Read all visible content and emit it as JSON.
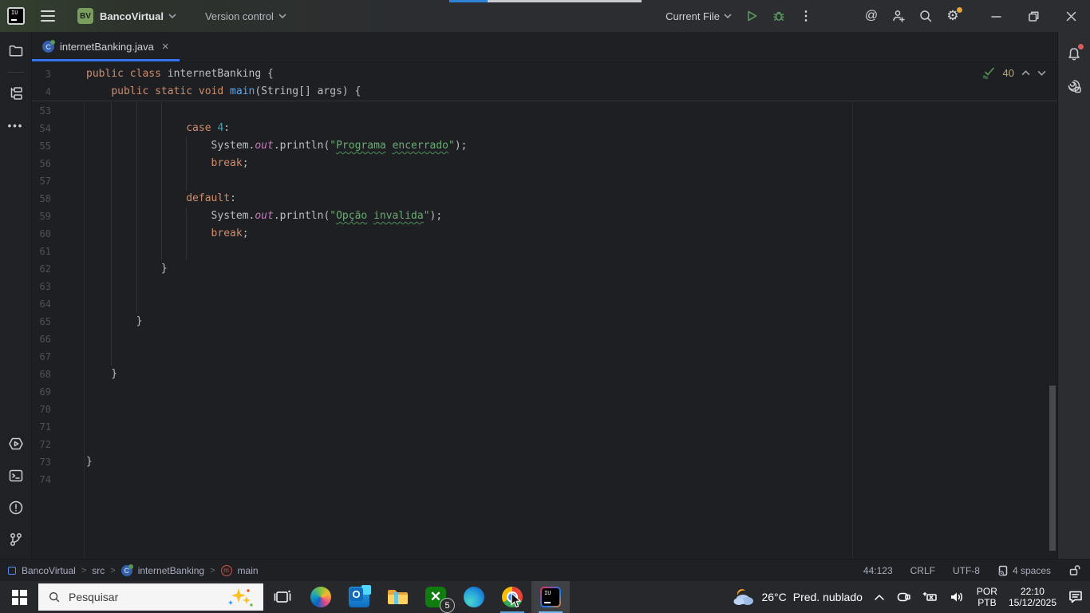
{
  "colors": {
    "accent_blue": "#3574F0",
    "run_green": "#57965C",
    "keyword_orange": "#CF8E6D",
    "string_green": "#6AAB73",
    "warning_count": "#BBA76E",
    "project_avatar_green": "#7A9E5E"
  },
  "title_bar": {
    "app_icon": "intellij-idea-logo",
    "project_name": "BancoVirtual",
    "project_avatar_text": "BV",
    "version_control_label": "Version control",
    "run_widget": {
      "config_label": "Current File"
    },
    "right_icons": [
      "ai-assistant",
      "add-user",
      "search",
      "settings-gear",
      "minimize",
      "maximize-restore",
      "close"
    ]
  },
  "editor_tabs": {
    "active_tab": {
      "label": "internetBanking.java",
      "icon": "java-class",
      "close": "×"
    }
  },
  "editor": {
    "inspection_widget": {
      "count": "40",
      "icon": "inspections-ok-typos"
    },
    "sticky_lines": [
      {
        "n": "3",
        "g": [],
        "t": [
          [
            "public class ",
            "k"
          ],
          [
            "internetBanking {",
            "p"
          ]
        ]
      },
      {
        "n": "4",
        "g": [],
        "t": [
          [
            "    ",
            "p"
          ],
          [
            "public static void ",
            "k"
          ],
          [
            "main",
            "m"
          ],
          [
            "(String[] args) {",
            "p"
          ]
        ]
      }
    ],
    "lines": [
      {
        "n": "53",
        "g": [
          1,
          2,
          3
        ],
        "t": []
      },
      {
        "n": "54",
        "g": [
          1,
          2,
          3
        ],
        "t": [
          [
            "                ",
            "p"
          ],
          [
            "case ",
            "k"
          ],
          [
            "4",
            "n"
          ],
          [
            ":",
            "p"
          ]
        ]
      },
      {
        "n": "55",
        "g": [
          1,
          2,
          3,
          4
        ],
        "t": [
          [
            "                    ",
            "p"
          ],
          [
            "System.",
            "p"
          ],
          [
            "out",
            "f"
          ],
          [
            ".println(",
            "p"
          ],
          [
            "\"",
            "s"
          ],
          [
            "Programa",
            "w"
          ],
          [
            " ",
            "s"
          ],
          [
            "encerrado",
            "w"
          ],
          [
            "\"",
            "s"
          ],
          [
            ");",
            "p"
          ]
        ]
      },
      {
        "n": "56",
        "g": [
          1,
          2,
          3,
          4
        ],
        "t": [
          [
            "                    ",
            "p"
          ],
          [
            "break",
            "k"
          ],
          [
            ";",
            "p"
          ]
        ]
      },
      {
        "n": "57",
        "g": [
          1,
          2,
          3,
          4
        ],
        "t": []
      },
      {
        "n": "58",
        "g": [
          1,
          2,
          3
        ],
        "t": [
          [
            "                ",
            "p"
          ],
          [
            "default",
            "k"
          ],
          [
            ":",
            "p"
          ]
        ]
      },
      {
        "n": "59",
        "g": [
          1,
          2,
          3,
          4
        ],
        "t": [
          [
            "                    ",
            "p"
          ],
          [
            "System.",
            "p"
          ],
          [
            "out",
            "f"
          ],
          [
            ".println(",
            "p"
          ],
          [
            "\"",
            "s"
          ],
          [
            "Opção",
            "w"
          ],
          [
            " ",
            "s"
          ],
          [
            "invalida",
            "w"
          ],
          [
            "\"",
            "s"
          ],
          [
            ");",
            "p"
          ]
        ]
      },
      {
        "n": "60",
        "g": [
          1,
          2,
          3,
          4
        ],
        "t": [
          [
            "                    ",
            "p"
          ],
          [
            "break",
            "k"
          ],
          [
            ";",
            "p"
          ]
        ]
      },
      {
        "n": "61",
        "g": [
          1,
          2,
          3,
          4
        ],
        "t": []
      },
      {
        "n": "62",
        "g": [
          1,
          2
        ],
        "t": [
          [
            "            }",
            "p"
          ]
        ]
      },
      {
        "n": "63",
        "g": [
          1,
          2
        ],
        "t": []
      },
      {
        "n": "64",
        "g": [
          1,
          2
        ],
        "t": []
      },
      {
        "n": "65",
        "g": [
          1
        ],
        "t": [
          [
            "        }",
            "p"
          ]
        ]
      },
      {
        "n": "66",
        "g": [
          1
        ],
        "t": []
      },
      {
        "n": "67",
        "g": [
          1
        ],
        "t": []
      },
      {
        "n": "68",
        "g": [],
        "t": [
          [
            "    }",
            "p"
          ]
        ]
      },
      {
        "n": "69",
        "g": [],
        "t": []
      },
      {
        "n": "70",
        "g": [],
        "t": []
      },
      {
        "n": "71",
        "g": [],
        "t": []
      },
      {
        "n": "72",
        "g": [],
        "t": []
      },
      {
        "n": "73",
        "g": [],
        "t": [
          [
            "}",
            "p"
          ]
        ]
      },
      {
        "n": "74",
        "g": [],
        "t": []
      }
    ]
  },
  "left_toolbar": {
    "icons": [
      "project-folder",
      "structure",
      "more-tool-windows",
      "services",
      "terminal",
      "problems",
      "version-control-branch"
    ]
  },
  "right_toolbar": {
    "icons": [
      "notifications-bell",
      "ai-assistant-chat"
    ]
  },
  "status_bar": {
    "breadcrumbs": [
      {
        "label": "BancoVirtual",
        "icon": "project"
      },
      {
        "label": "src",
        "icon": ""
      },
      {
        "label": "internetBanking",
        "icon": "class"
      },
      {
        "label": "main",
        "icon": "method"
      }
    ],
    "caret_position": "44:123",
    "line_separator": "CRLF",
    "encoding": "UTF-8",
    "indent": "4 spaces",
    "lock_icon": "unlocked"
  },
  "taskbar": {
    "start": "windows-logo",
    "search": {
      "placeholder": "Pesquisar",
      "icons": [
        "search-magnifier",
        "copilot-sparkles"
      ]
    },
    "apps": [
      "task-view",
      "copilot",
      "outlook",
      "file-explorer",
      "xbox",
      "edge",
      "chrome",
      "intellij-idea"
    ],
    "xbox_badge": "5",
    "running_apps": [
      "chrome",
      "intellij-idea"
    ],
    "active_app": "intellij-idea",
    "tray": {
      "temperature": "26°C",
      "weather_desc": "Pred. nublado",
      "icons": [
        "hidden-icons-chevron",
        "meet-now",
        "battery-input",
        "volume"
      ],
      "lang_line1": "POR",
      "lang_line2": "PTB",
      "time": "22:10",
      "date": "15/12/2025",
      "action_center": "notifications-panel"
    }
  }
}
